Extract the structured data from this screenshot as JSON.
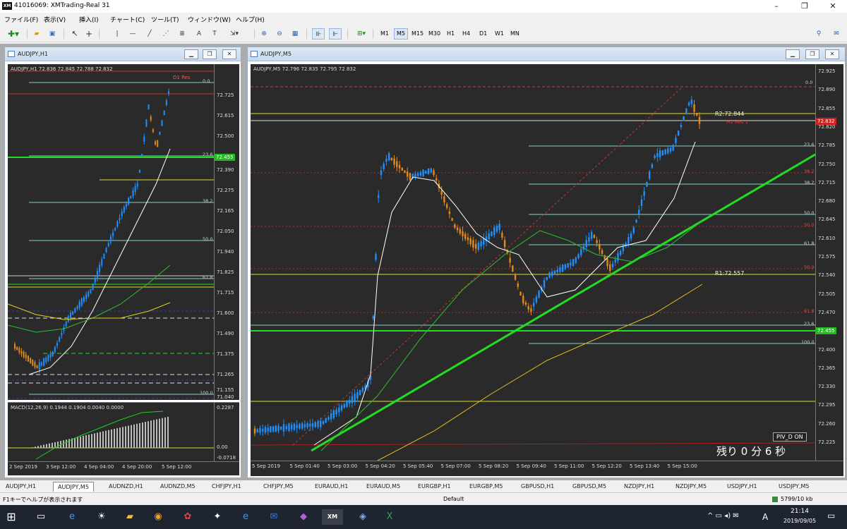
{
  "titlebar": {
    "title": "41016069: XMTrading-Real 31",
    "logo": "XM",
    "minimize": "–",
    "maximize": "❐",
    "close": "✕"
  },
  "menu": [
    "ファイル(F)",
    "表示(V)",
    "挿入(I)",
    "チャート(C)",
    "ツール(T)",
    "ウィンドウ(W)",
    "ヘルプ(H)"
  ],
  "toolbar": {
    "timeframes": [
      "M1",
      "M5",
      "M15",
      "M30",
      "H1",
      "H4",
      "D1",
      "W1",
      "MN"
    ],
    "selected": "M5"
  },
  "left_chart": {
    "window_title": "AUDJPY,H1",
    "header": "AUDJPY,H1  72.836 72.845 72.788 72.832",
    "yticks": [
      "72.725",
      "72.615",
      "72.500",
      "72.390",
      "72.275",
      "72.165",
      "72.050",
      "71.940",
      "71.825",
      "71.715",
      "71.600",
      "71.490",
      "71.375",
      "71.265",
      "71.155",
      "71.040"
    ],
    "xticks": [
      "2 Sep 2019",
      "3 Sep 12:00",
      "4 Sep 04:00",
      "4 Sep 20:00",
      "5 Sep 12:00"
    ],
    "fib": [
      "0.0",
      "23.6",
      "38.2",
      "50.0",
      "61.8",
      "100.0"
    ],
    "tags": {
      "d1": "D1 Res",
      "price": "72.455"
    },
    "macd_header": "MACD(12,26,9) 0.1944 0.1904 0.0040 0.0000",
    "macd_ticks": [
      "0.2287",
      "0.00",
      "-0.0718"
    ]
  },
  "right_chart": {
    "window_title": "AUDJPY,M5",
    "header": "AUDJPY,M5  72.796 72.835 72.795 72.832",
    "yticks": [
      "72.925",
      "72.890",
      "72.855",
      "72.820",
      "72.785",
      "72.750",
      "72.715",
      "72.680",
      "72.645",
      "72.610",
      "72.575",
      "72.540",
      "72.505",
      "72.470",
      "72.435",
      "72.400",
      "72.365",
      "72.330",
      "72.295",
      "72.260",
      "72.225"
    ],
    "xticks": [
      "5 Sep 2019",
      "5 Sep 01:40",
      "5 Sep 03:00",
      "5 Sep 04:20",
      "5 Sep 05:40",
      "5 Sep 07:00",
      "5 Sep 08:20",
      "5 Sep 09:40",
      "5 Sep 11:00",
      "5 Sep 12:20",
      "5 Sep 13:40",
      "5 Sep 15:00"
    ],
    "fib": [
      "0.0",
      "23.6",
      "38.2",
      "50.0",
      "61.8",
      "100.0"
    ],
    "fib2": [
      "38.2",
      "50.0",
      "61.8",
      "23.6"
    ],
    "r2": "R2:72.844",
    "r1": "R1:72.557",
    "price_tag": "72.455",
    "current_tag": "72.832",
    "h1res": "H1 Res 1",
    "piv": "PIV_D ON",
    "countdown": "残り 0 分 6 秒"
  },
  "tabs": [
    "AUDJPY,H1",
    "AUDJPY,M5",
    "AUDNZD,H1",
    "AUDNZD,M5",
    "CHFJPY,H1",
    "CHFJPY,M5",
    "EURAUD,H1",
    "EURAUD,M5",
    "EURGBP,H1",
    "EURGBP,M5",
    "GBPUSD,H1",
    "GBPUSD,M5",
    "NZDJPY,H1",
    "NZDJPY,M5",
    "USDJPY,H1",
    "USDJPY,M5"
  ],
  "active_tab": "AUDJPY,M5",
  "status": {
    "help": "F1キーでヘルプが表示されます",
    "profile": "Default",
    "traffic": "5799/10 kb"
  },
  "taskbar": {
    "time": "21:14",
    "date": "2019/09/05",
    "ime": "A"
  },
  "colors": {
    "chart_bg": "#2a2a2a",
    "bull": "#1e90ff",
    "bear": "#e08a1e",
    "trend": "#22dd22",
    "fib": "#7fd4c8"
  }
}
